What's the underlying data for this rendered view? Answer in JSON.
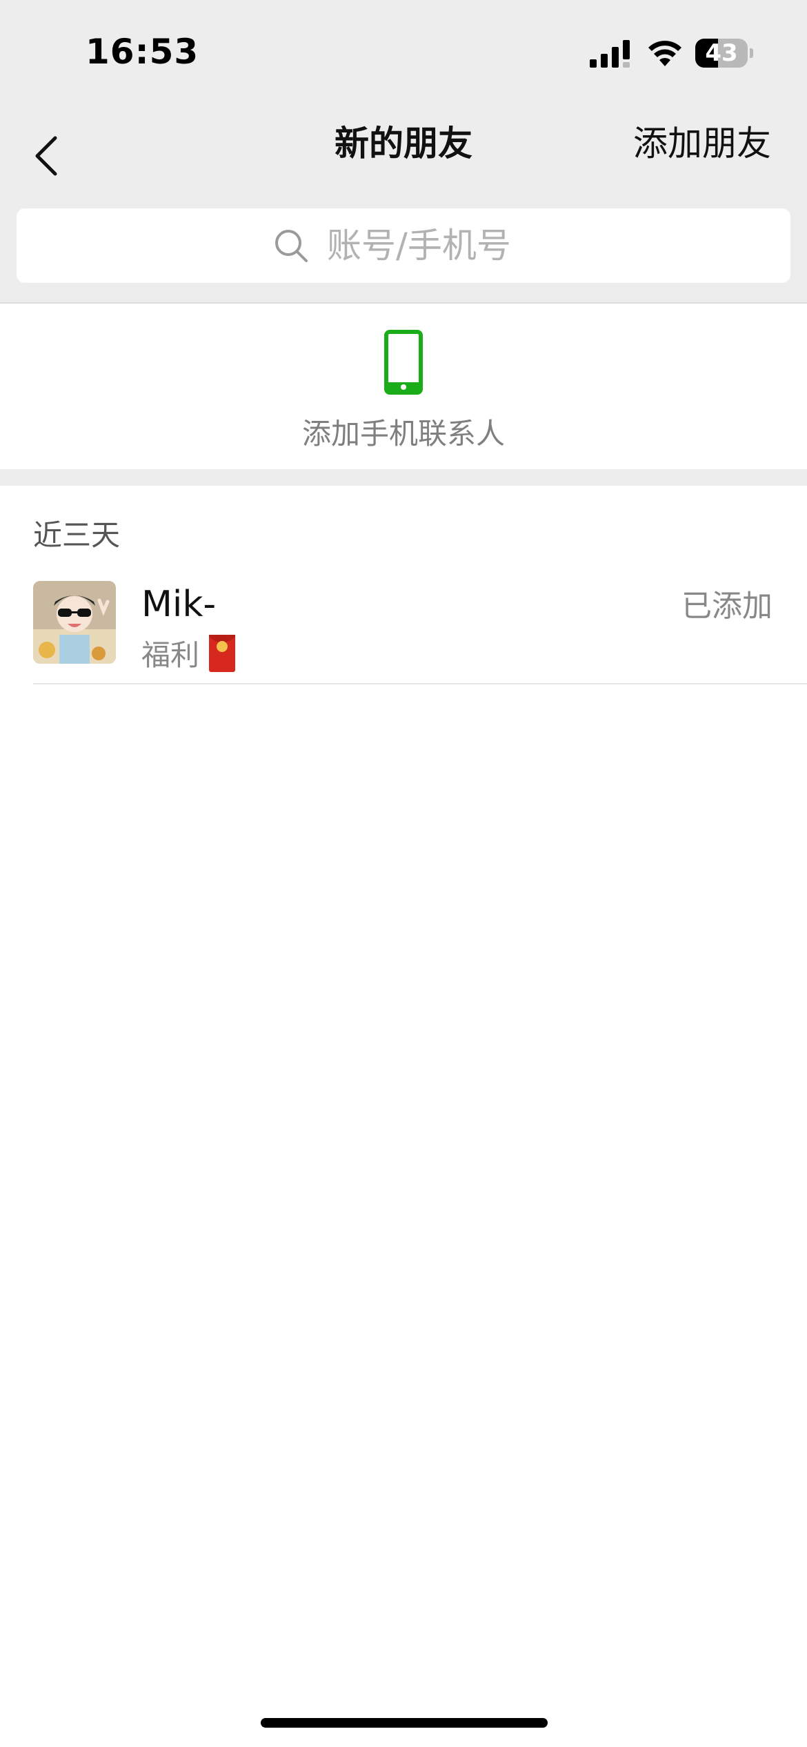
{
  "status_bar": {
    "time": "16:53",
    "battery_level": "43",
    "battery_fraction": 0.43,
    "icons": [
      "signal-icon",
      "wifi-icon",
      "battery-icon"
    ]
  },
  "nav": {
    "back_icon": "chevron-left-icon",
    "title": "新的朋友",
    "add_friend_label": "添加朋友"
  },
  "search": {
    "icon": "search-icon",
    "placeholder": "账号/手机号"
  },
  "phone_contacts": {
    "icon": "mobile-phone-icon",
    "label": "添加手机联系人",
    "icon_color": "#1aad19"
  },
  "recent": {
    "section_label": "近三天",
    "friends": [
      {
        "name": "Mik-",
        "message": "福利",
        "message_icon": "red-envelope-icon",
        "status": "已添加"
      }
    ]
  },
  "colors": {
    "nav_background": "#ededed",
    "accent_green": "#1aad19",
    "secondary_text": "#888888"
  }
}
